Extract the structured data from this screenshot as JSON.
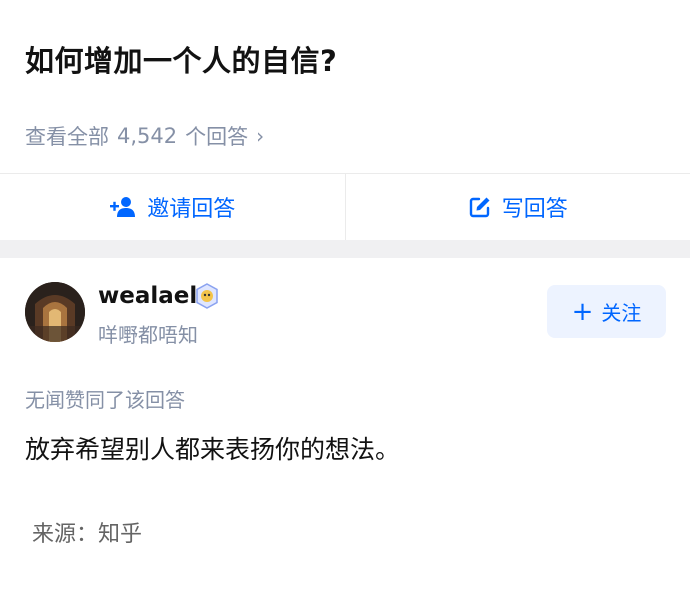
{
  "question": {
    "title": "如何增加一个人的自信?",
    "view_all_label": "查看全部",
    "answer_count": "4,542",
    "answer_count_suffix": "个回答",
    "chevron": "›"
  },
  "actions": {
    "invite_label": "邀请回答",
    "write_label": "写回答"
  },
  "answer": {
    "author_name": "wealael",
    "author_bio": "咩嘢都唔知",
    "follow_label": "关注",
    "upvote_line": "无闻赞同了该回答",
    "content": "放弃希望别人都来表扬你的想法。",
    "source": "来源：知乎"
  },
  "colors": {
    "accent": "#0066ff",
    "muted": "#8590a6",
    "follow_bg": "#edf3ff",
    "divider": "#f0f0f2"
  },
  "icons": {
    "invite": "add-user-icon",
    "write": "edit-icon",
    "badge": "verified-badge-icon",
    "follow": "plus-icon",
    "view_all": "chevron-right-icon"
  }
}
